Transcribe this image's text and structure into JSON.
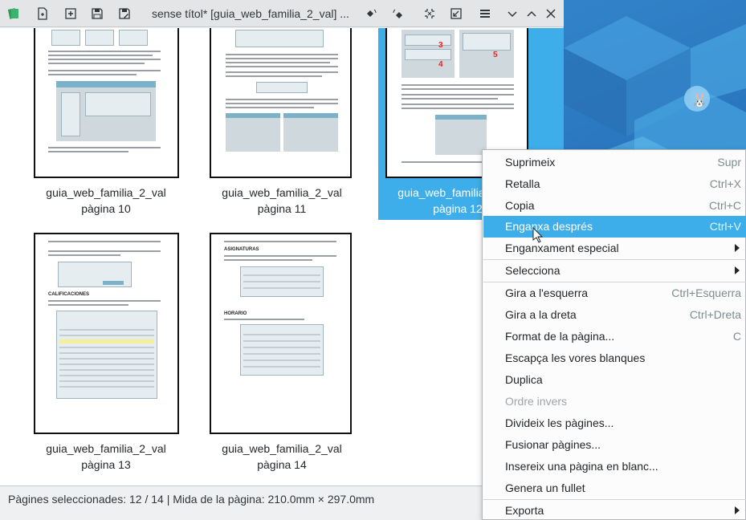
{
  "window": {
    "title": "sense títol* [guia_web_familia_2_val] ..."
  },
  "toolbar": {
    "icons": [
      "app-icon",
      "open-icon",
      "import-icon",
      "save-icon",
      "save-as-icon",
      "rotate-left-icon",
      "rotate-right-icon",
      "crop-icon",
      "resize-icon",
      "menu-icon",
      "minimize-icon",
      "maximize-icon",
      "close-icon"
    ]
  },
  "pages": [
    {
      "name": "guia_web_familia_2_val",
      "page": "pàgina 10",
      "selected": false
    },
    {
      "name": "guia_web_familia_2_val",
      "page": "pàgina 11",
      "selected": false
    },
    {
      "name": "guia_web_familia_2_val",
      "page": "pàgina 12",
      "selected": true
    },
    {
      "name": "guia_web_familia_2_val",
      "page": "pàgina 13",
      "selected": false
    },
    {
      "name": "guia_web_familia_2_val",
      "page": "pàgina 14",
      "selected": false
    }
  ],
  "page_marks": {
    "p12_numbers": [
      "3",
      "4",
      "5"
    ],
    "p13_heading": "CALIFICACIONES",
    "p14_heading1": "ASIGNATURAS",
    "p14_heading2": "HORARIO"
  },
  "status": {
    "text": "Pàgines seleccionades: 12 / 14 | Mida de la pàgina: 210.0mm × 297.0mm"
  },
  "menu": {
    "items": [
      {
        "label": "Suprimeix",
        "shortcut": "Supr"
      },
      {
        "label": "Retalla",
        "shortcut": "Ctrl+X"
      },
      {
        "label": "Copia",
        "shortcut": "Ctrl+C"
      },
      {
        "label": "Enganxa després",
        "shortcut": "Ctrl+V"
      },
      {
        "label": "Enganxament especial",
        "shortcut": ""
      },
      {
        "label": "Selecciona",
        "shortcut": ""
      },
      {
        "label": "Gira a l'esquerra",
        "shortcut": "Ctrl+Esquerra"
      },
      {
        "label": "Gira a la dreta",
        "shortcut": "Ctrl+Dreta"
      },
      {
        "label": "Format de la pàgina...",
        "shortcut": "C"
      },
      {
        "label": "Escapça les vores blanques",
        "shortcut": ""
      },
      {
        "label": "Duplica",
        "shortcut": ""
      },
      {
        "label": "Ordre invers",
        "shortcut": ""
      },
      {
        "label": "Divideix les pàgines...",
        "shortcut": ""
      },
      {
        "label": "Fusionar pàgines...",
        "shortcut": ""
      },
      {
        "label": "Insereix una pàgina en blanc...",
        "shortcut": ""
      },
      {
        "label": "Genera un fullet",
        "shortcut": ""
      },
      {
        "label": "Exporta",
        "shortcut": ""
      }
    ],
    "highlighted": "Enganxa després",
    "disabled": "Ordre invers"
  },
  "colors": {
    "selection": "#3daee9",
    "window_bg": "#eff0f1",
    "desktop": "#2b78c0"
  }
}
